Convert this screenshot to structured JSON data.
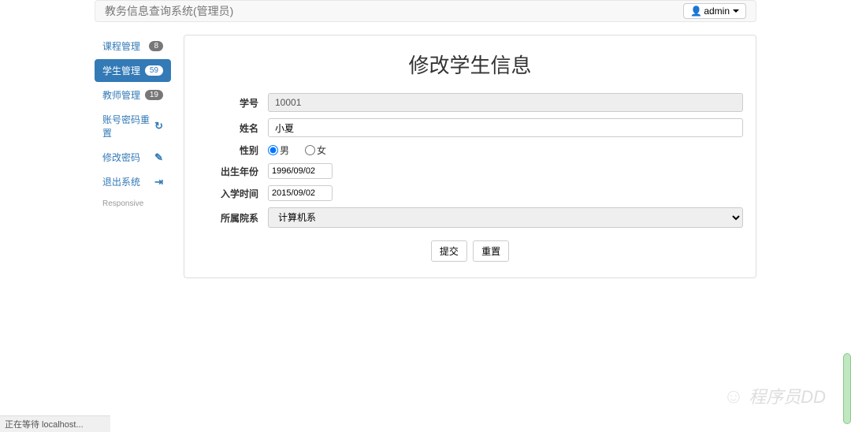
{
  "navbar": {
    "brand": "教务信息查询系统(管理员)",
    "user_label": "admin"
  },
  "sidebar": {
    "items": [
      {
        "label": "课程管理",
        "badge": "8"
      },
      {
        "label": "学生管理",
        "badge": "59"
      },
      {
        "label": "教师管理",
        "badge": "19"
      },
      {
        "label": "账号密码重置"
      },
      {
        "label": "修改密码"
      },
      {
        "label": "退出系统"
      }
    ],
    "footer": "Responsive"
  },
  "panel": {
    "title": "修改学生信息"
  },
  "form": {
    "student_id_label": "学号",
    "student_id_value": "10001",
    "name_label": "姓名",
    "name_value": "小夏",
    "gender_label": "性别",
    "gender_male": "男",
    "gender_female": "女",
    "gender_selected": "男",
    "birth_label": "出生年份",
    "birth_value": "1996/09/02",
    "enroll_label": "入学时间",
    "enroll_value": "2015/09/02",
    "dept_label": "所属院系",
    "dept_selected": "计算机系",
    "submit_label": "提交",
    "reset_label": "重置"
  },
  "status": "正在等待 localhost...",
  "watermark": "程序员DD"
}
